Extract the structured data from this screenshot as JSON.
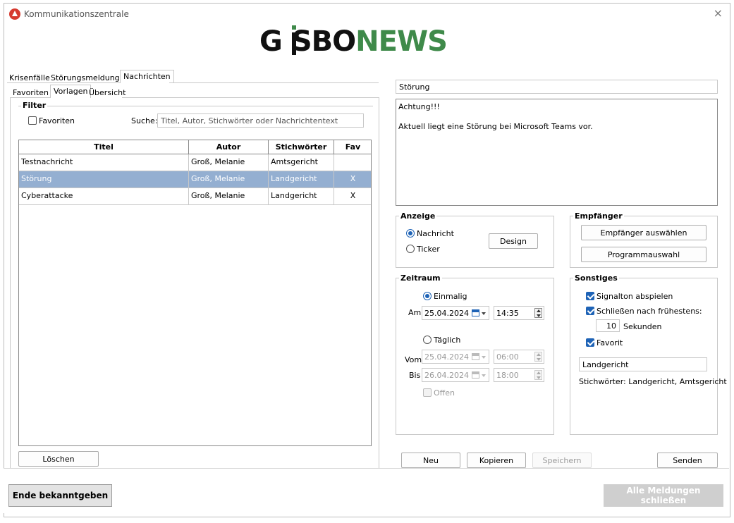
{
  "window": {
    "title": "Kommunikationszentrale",
    "close_glyph": "×"
  },
  "logo": {
    "part1": "G",
    "part2": "SBO",
    "part3": "NEWS"
  },
  "main_tabs": [
    "Krisenfälle",
    "Störungsmeldungen",
    "Nachrichten"
  ],
  "sub_tabs": [
    "Favoriten",
    "Vorlagen",
    "Übersicht"
  ],
  "filter": {
    "title": "Filter",
    "favoriten_label": "Favoriten",
    "favoriten_checked": false,
    "search_label": "Suche:",
    "search_placeholder": "Titel, Autor, Stichwörter oder Nachrichtentext",
    "search_value": ""
  },
  "table": {
    "headers": [
      "Titel",
      "Autor",
      "Stichwörter",
      "Fav"
    ],
    "rows": [
      [
        "Testnachricht",
        "Groß, Melanie",
        "Amtsgericht",
        ""
      ],
      [
        "Störung",
        "Groß, Melanie",
        "Landgericht",
        "X"
      ],
      [
        "Cyberattacke",
        "Groß, Melanie",
        "Landgericht",
        "X"
      ]
    ],
    "selected_row": 1
  },
  "loeschen_button": "Löschen",
  "message": {
    "subject": "Störung",
    "body": "Achtung!!!\n\nAktuell liegt eine Störung bei Microsoft Teams vor."
  },
  "anzeige": {
    "title": "Anzeige",
    "options": [
      "Nachricht",
      "Ticker"
    ],
    "selected": "Nachricht",
    "design_button": "Design"
  },
  "empfaenger": {
    "title": "Empfänger",
    "select_button": "Empfänger auswählen",
    "program_button": "Programmauswahl"
  },
  "zeitraum": {
    "title": "Zeitraum",
    "einmalig_label": "Einmalig",
    "einmalig_selected": true,
    "am_label": "Am",
    "am_date": "25.04.2024",
    "am_time": "14:35",
    "taeglich_label": "Täglich",
    "vom_label": "Vom",
    "vom_date": "25.04.2024",
    "vom_time": "06:00",
    "bis_label": "Bis",
    "bis_date": "26.04.2024",
    "bis_time": "18:00",
    "offen_label": "Offen"
  },
  "sonstiges": {
    "title": "Sonstiges",
    "signalton_label": "Signalton abspielen",
    "schliessen_label": "Schließen nach frühestens:",
    "seconds_value": "10",
    "seconds_label": "Sekunden",
    "favorit_label": "Favorit",
    "keyword_value": "Landgericht",
    "keywords_text": "Stichwörter: Landgericht, Amtsgericht"
  },
  "actions": {
    "neu": "Neu",
    "kopieren": "Kopieren",
    "speichern": "Speichern",
    "senden": "Senden"
  },
  "footer": {
    "ende_button": "Ende bekanntgeben",
    "alle_button": "Alle Meldungen schließen"
  },
  "colors": {
    "accent": "#1e63b6",
    "selection": "#94afd1",
    "logo_green": "#3f8a4a",
    "app_icon": "#d63a2f"
  }
}
